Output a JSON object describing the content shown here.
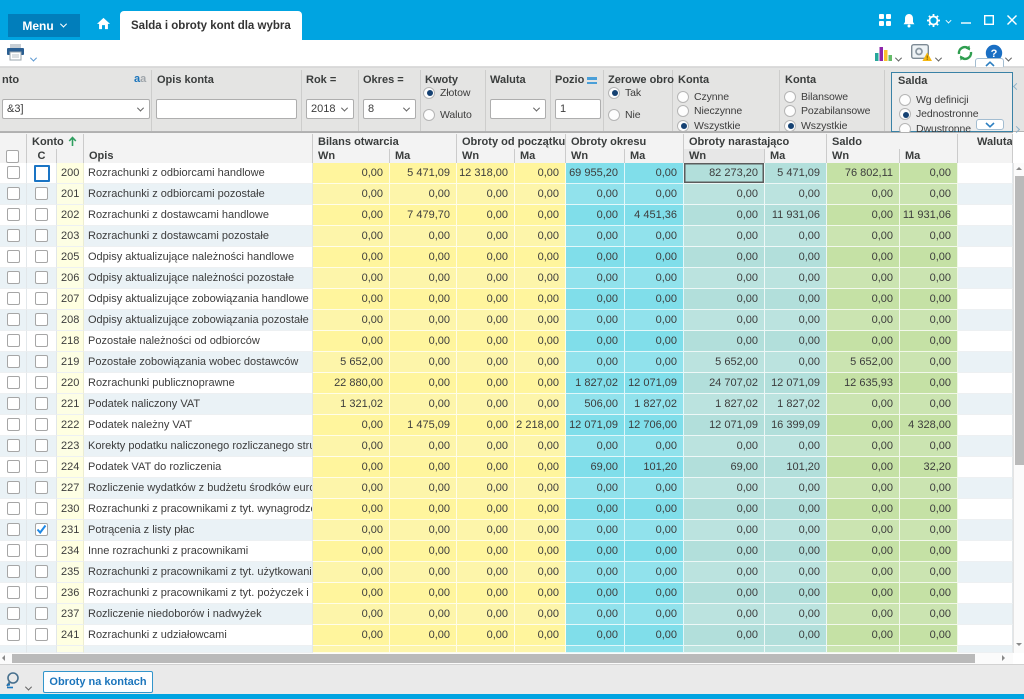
{
  "titlebar": {
    "menu_label": "Menu",
    "tab_title": "Salda i obroty kont dla wybra"
  },
  "filters": {
    "konto": {
      "label": "nto",
      "value": "&3]"
    },
    "opis_konta": {
      "label": "Opis konta",
      "value": ""
    },
    "rok": {
      "label": "Rok =",
      "value": "2018"
    },
    "okres": {
      "label": "Okres =",
      "value": "8"
    },
    "kwoty": {
      "label": "Kwoty",
      "options": [
        "Złotow",
        "Waluto"
      ],
      "selected": "Złotow"
    },
    "waluta": {
      "label": "Waluta",
      "value": ""
    },
    "poziom": {
      "label": "Pozio",
      "value": "1"
    },
    "zerowe_obroty": {
      "label": "Zerowe obro",
      "options": [
        "Tak",
        "Nie"
      ],
      "selected": "Tak"
    },
    "konta_aktywnosc": {
      "label": "Konta",
      "options": [
        "Czynne",
        "Nieczynne",
        "Wszystkie"
      ],
      "selected": "Wszystkie"
    },
    "konta_typ": {
      "label": "Konta",
      "options": [
        "Bilansowe",
        "Pozabilansowe",
        "Wszystkie"
      ],
      "selected": "Wszystkie"
    },
    "salda": {
      "label": "Salda",
      "options": [
        "Wg definicji",
        "Jednostronne",
        "Dwustronne"
      ],
      "selected": "Jednostronne"
    }
  },
  "table": {
    "groups": {
      "konto": "Konto",
      "bilans_otwarcia": "Bilans otwarcia",
      "obroty_od_poczatku": "Obroty od początku r",
      "obroty_okresu": "Obroty okresu",
      "obroty_narastajaco": "Obroty narastająco",
      "saldo": "Saldo",
      "waluta": "Waluta"
    },
    "subheaders": {
      "c": "C",
      "opis": "Opis",
      "wn": "Wn",
      "ma": "Ma"
    },
    "selection": {
      "row_konto": "200",
      "selected_cell": "on_wn",
      "focused_checkbox_row": "200"
    },
    "rows": [
      {
        "konto": "200",
        "opis": "Rozrachunki z odbiorcami handlowe",
        "checked": false,
        "vals": [
          "0,00",
          "5 471,09",
          "12 318,00",
          "0,00",
          "69 955,20",
          "0,00",
          "82 273,20",
          "5 471,09",
          "76 802,11",
          "0,00"
        ]
      },
      {
        "konto": "201",
        "opis": "Rozrachunki z odbiorcami pozostałe",
        "checked": false,
        "vals": [
          "0,00",
          "0,00",
          "0,00",
          "0,00",
          "0,00",
          "0,00",
          "0,00",
          "0,00",
          "0,00",
          "0,00"
        ]
      },
      {
        "konto": "202",
        "opis": "Rozrachunki z dostawcami handlowe",
        "checked": false,
        "vals": [
          "0,00",
          "7 479,70",
          "0,00",
          "0,00",
          "0,00",
          "4 451,36",
          "0,00",
          "11 931,06",
          "0,00",
          "11 931,06"
        ]
      },
      {
        "konto": "203",
        "opis": "Rozrachunki z dostawcami pozostałe",
        "checked": false,
        "vals": [
          "0,00",
          "0,00",
          "0,00",
          "0,00",
          "0,00",
          "0,00",
          "0,00",
          "0,00",
          "0,00",
          "0,00"
        ]
      },
      {
        "konto": "205",
        "opis": "Odpisy aktualizujące należności handlowe",
        "checked": false,
        "vals": [
          "0,00",
          "0,00",
          "0,00",
          "0,00",
          "0,00",
          "0,00",
          "0,00",
          "0,00",
          "0,00",
          "0,00"
        ]
      },
      {
        "konto": "206",
        "opis": "Odpisy aktualizujące należności pozostałe",
        "checked": false,
        "vals": [
          "0,00",
          "0,00",
          "0,00",
          "0,00",
          "0,00",
          "0,00",
          "0,00",
          "0,00",
          "0,00",
          "0,00"
        ]
      },
      {
        "konto": "207",
        "opis": "Odpisy aktualizujące zobowiązania handlowe",
        "checked": false,
        "vals": [
          "0,00",
          "0,00",
          "0,00",
          "0,00",
          "0,00",
          "0,00",
          "0,00",
          "0,00",
          "0,00",
          "0,00"
        ]
      },
      {
        "konto": "208",
        "opis": "Odpisy aktualizujące zobowiązania pozostałe",
        "checked": false,
        "vals": [
          "0,00",
          "0,00",
          "0,00",
          "0,00",
          "0,00",
          "0,00",
          "0,00",
          "0,00",
          "0,00",
          "0,00"
        ]
      },
      {
        "konto": "218",
        "opis": "Pozostałe należności od odbiorców",
        "checked": false,
        "vals": [
          "0,00",
          "0,00",
          "0,00",
          "0,00",
          "0,00",
          "0,00",
          "0,00",
          "0,00",
          "0,00",
          "0,00"
        ]
      },
      {
        "konto": "219",
        "opis": "Pozostałe zobowiązania wobec dostawców",
        "checked": false,
        "vals": [
          "5 652,00",
          "0,00",
          "0,00",
          "0,00",
          "0,00",
          "0,00",
          "5 652,00",
          "0,00",
          "5 652,00",
          "0,00"
        ]
      },
      {
        "konto": "220",
        "opis": "Rozrachunki publicznoprawne",
        "checked": false,
        "vals": [
          "22 880,00",
          "0,00",
          "0,00",
          "0,00",
          "1 827,02",
          "12 071,09",
          "24 707,02",
          "12 071,09",
          "12 635,93",
          "0,00"
        ]
      },
      {
        "konto": "221",
        "opis": "Podatek naliczony VAT",
        "checked": false,
        "vals": [
          "1 321,02",
          "0,00",
          "0,00",
          "0,00",
          "506,00",
          "1 827,02",
          "1 827,02",
          "1 827,02",
          "0,00",
          "0,00"
        ]
      },
      {
        "konto": "222",
        "opis": "Podatek należny VAT",
        "checked": false,
        "vals": [
          "0,00",
          "1 475,09",
          "0,00",
          "2 218,00",
          "12 071,09",
          "12 706,00",
          "12 071,09",
          "16 399,09",
          "0,00",
          "4 328,00"
        ]
      },
      {
        "konto": "223",
        "opis": "Korekty podatku naliczonego rozliczanego stru",
        "checked": false,
        "vals": [
          "0,00",
          "0,00",
          "0,00",
          "0,00",
          "0,00",
          "0,00",
          "0,00",
          "0,00",
          "0,00",
          "0,00"
        ]
      },
      {
        "konto": "224",
        "opis": "Podatek VAT do rozliczenia",
        "checked": false,
        "vals": [
          "0,00",
          "0,00",
          "0,00",
          "0,00",
          "69,00",
          "101,20",
          "69,00",
          "101,20",
          "0,00",
          "32,20"
        ]
      },
      {
        "konto": "227",
        "opis": "Rozliczenie wydatków z budżetu środków euro",
        "checked": false,
        "vals": [
          "0,00",
          "0,00",
          "0,00",
          "0,00",
          "0,00",
          "0,00",
          "0,00",
          "0,00",
          "0,00",
          "0,00"
        ]
      },
      {
        "konto": "230",
        "opis": "Rozrachunki z pracownikami z tyt. wynagrodze",
        "checked": false,
        "vals": [
          "0,00",
          "0,00",
          "0,00",
          "0,00",
          "0,00",
          "0,00",
          "0,00",
          "0,00",
          "0,00",
          "0,00"
        ]
      },
      {
        "konto": "231",
        "opis": "Potrącenia z listy płac",
        "checked": true,
        "vals": [
          "0,00",
          "0,00",
          "0,00",
          "0,00",
          "0,00",
          "0,00",
          "0,00",
          "0,00",
          "0,00",
          "0,00"
        ]
      },
      {
        "konto": "234",
        "opis": "Inne rozrachunki z pracownikami",
        "checked": false,
        "vals": [
          "0,00",
          "0,00",
          "0,00",
          "0,00",
          "0,00",
          "0,00",
          "0,00",
          "0,00",
          "0,00",
          "0,00"
        ]
      },
      {
        "konto": "235",
        "opis": "Rozrachunki z pracownikami z tyt. użytkowani",
        "checked": false,
        "vals": [
          "0,00",
          "0,00",
          "0,00",
          "0,00",
          "0,00",
          "0,00",
          "0,00",
          "0,00",
          "0,00",
          "0,00"
        ]
      },
      {
        "konto": "236",
        "opis": "Rozrachunki z pracownikami z tyt. pożyczek i ś",
        "checked": false,
        "vals": [
          "0,00",
          "0,00",
          "0,00",
          "0,00",
          "0,00",
          "0,00",
          "0,00",
          "0,00",
          "0,00",
          "0,00"
        ]
      },
      {
        "konto": "237",
        "opis": "Rozliczenie niedoborów i nadwyżek",
        "checked": false,
        "vals": [
          "0,00",
          "0,00",
          "0,00",
          "0,00",
          "0,00",
          "0,00",
          "0,00",
          "0,00",
          "0,00",
          "0,00"
        ]
      },
      {
        "konto": "241",
        "opis": "Rozrachunki z udziałowcami",
        "checked": false,
        "vals": [
          "0,00",
          "0,00",
          "0,00",
          "0,00",
          "0,00",
          "0,00",
          "0,00",
          "0,00",
          "0,00",
          "0,00"
        ]
      }
    ]
  },
  "footer": {
    "button_label": "Obroty na kontach"
  },
  "colors": {
    "titlebar": "#00a4e1",
    "menu_button": "#017ebb",
    "col_bilans": "#fff59d",
    "col_obroty_okresu": "#80deea",
    "col_obroty_narastajaco": "#b2dfdb",
    "col_saldo": "#c5e1a5",
    "radio_dot": "#154172",
    "salda_box_border": "#3a82a6"
  }
}
